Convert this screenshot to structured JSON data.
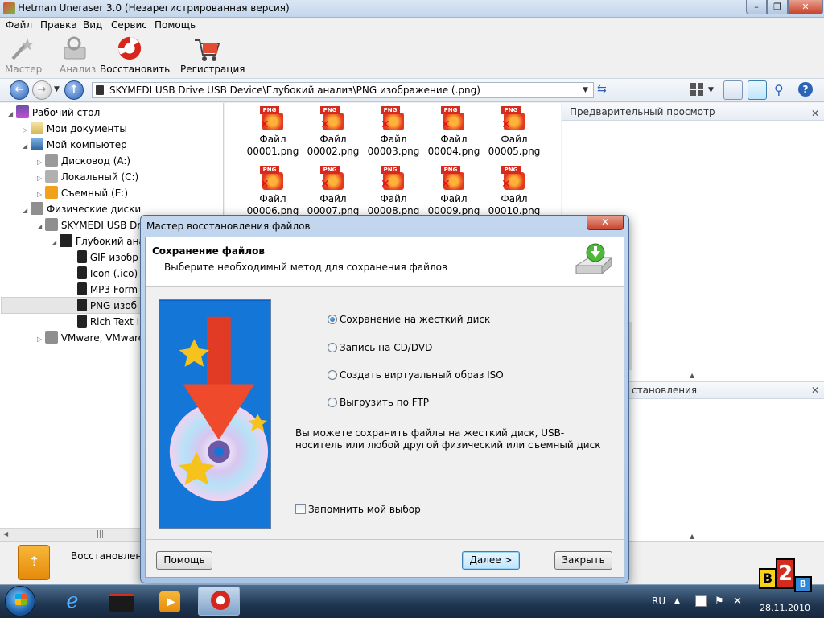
{
  "window": {
    "title": "Hetman Uneraser 3.0   (Незарегистрированная версия)",
    "min": "–",
    "max": "❐",
    "close": "✕"
  },
  "menu": [
    "Файл",
    "Правка",
    "Вид",
    "Сервис",
    "Помощь"
  ],
  "toolbar": {
    "wizard": "Мастер",
    "analysis": "Анализ",
    "restore": "Восстановить",
    "register": "Регистрация"
  },
  "address": {
    "path": "SKYMEDI USB Drive USB Device\\Глубокий анализ\\PNG изображение (.png)"
  },
  "tree": [
    {
      "label": "Рабочий стол"
    },
    {
      "label": "Мои документы"
    },
    {
      "label": "Мой компьютер"
    },
    {
      "label": "Дисковод (A:)"
    },
    {
      "label": "Локальный (C:)"
    },
    {
      "label": "Съемный (E:)"
    },
    {
      "label": "Физические диски"
    },
    {
      "label": "SKYMEDI USB Driv"
    },
    {
      "label": "Глубокий ана"
    },
    {
      "label": "GIF изобр"
    },
    {
      "label": "Icon (.ico)"
    },
    {
      "label": "MP3 Form"
    },
    {
      "label": "PNG изоб"
    },
    {
      "label": "Rich Text I"
    },
    {
      "label": "VMware, VMware"
    }
  ],
  "files": [
    {
      "line1": "Файл",
      "line2": "00001.png"
    },
    {
      "line1": "Файл",
      "line2": "00002.png"
    },
    {
      "line1": "Файл",
      "line2": "00003.png"
    },
    {
      "line1": "Файл",
      "line2": "00004.png"
    },
    {
      "line1": "Файл",
      "line2": "00005.png"
    },
    {
      "line1": "Файл",
      "line2": "00006.png"
    },
    {
      "line1": "Файл",
      "line2": "00007.png"
    },
    {
      "line1": "Файл",
      "line2": "00008.png"
    },
    {
      "line1": "Файл",
      "line2": "00009.png"
    },
    {
      "line1": "Файл",
      "line2": "00010.png"
    }
  ],
  "png_tag": "PNG",
  "preview": {
    "title": "Предварительный просмотр",
    "restore_title": "становления"
  },
  "status": {
    "text": "Восстановлени"
  },
  "dialog": {
    "title": "Мастер восстановления файлов",
    "heading": "Сохранение файлов",
    "subheading": "Выберите необходимый метод для сохранения файлов",
    "options": [
      {
        "label": "Сохранение на жесткий диск",
        "selected": true
      },
      {
        "label": "Запись на CD/DVD",
        "selected": false
      },
      {
        "label": "Создать виртуальный образ ISO",
        "selected": false
      },
      {
        "label": "Выгрузить по FTP",
        "selected": false
      }
    ],
    "hint": "Вы можете сохранить файлы на жесткий диск, USB-носитель или любой другой физический или съемный диск",
    "remember": "Запомнить мой выбор",
    "help": "Помощь",
    "next": "Далее >",
    "close": "Закрыть",
    "close_icon": "✕"
  },
  "taskbar": {
    "lang": "RU",
    "date": "28.11.2010"
  },
  "badge": {
    "letter_b": "B",
    "digit": "2",
    "letter_v": "B"
  },
  "colors": {
    "accent": "#2c63b8",
    "close_red": "#c7432d",
    "taskbar": "#1f3550"
  }
}
